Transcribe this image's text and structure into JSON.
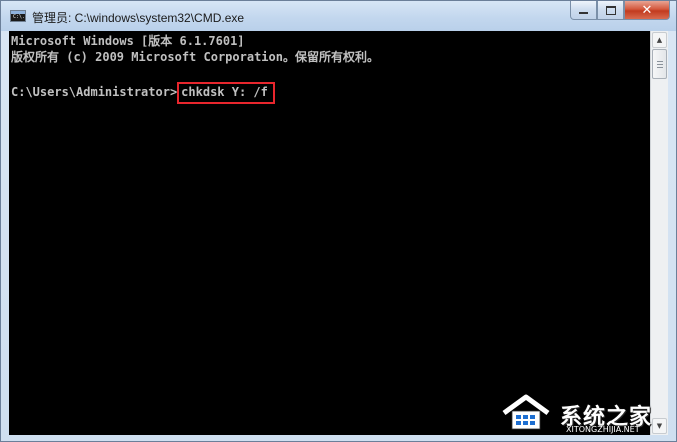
{
  "window": {
    "title": "管理员: C:\\windows\\system32\\CMD.exe",
    "icon_text": "C:\\.",
    "controls": {
      "minimize": "minimize-icon",
      "maximize": "maximize-icon",
      "close": "✕"
    }
  },
  "console": {
    "line1": "Microsoft Windows [版本 6.1.7601]",
    "line2": "版权所有 (c) 2009 Microsoft Corporation。保留所有权利。",
    "prompt": "C:\\Users\\Administrator>",
    "command": "chkdsk Y: /f",
    "highlight_color": "#e8262d"
  },
  "scrollbar": {
    "up_arrow": "▲",
    "down_arrow": "▼",
    "position": 0
  },
  "watermark": {
    "brand": "系统之家",
    "url": "XITONGZHIJIA.NET"
  }
}
